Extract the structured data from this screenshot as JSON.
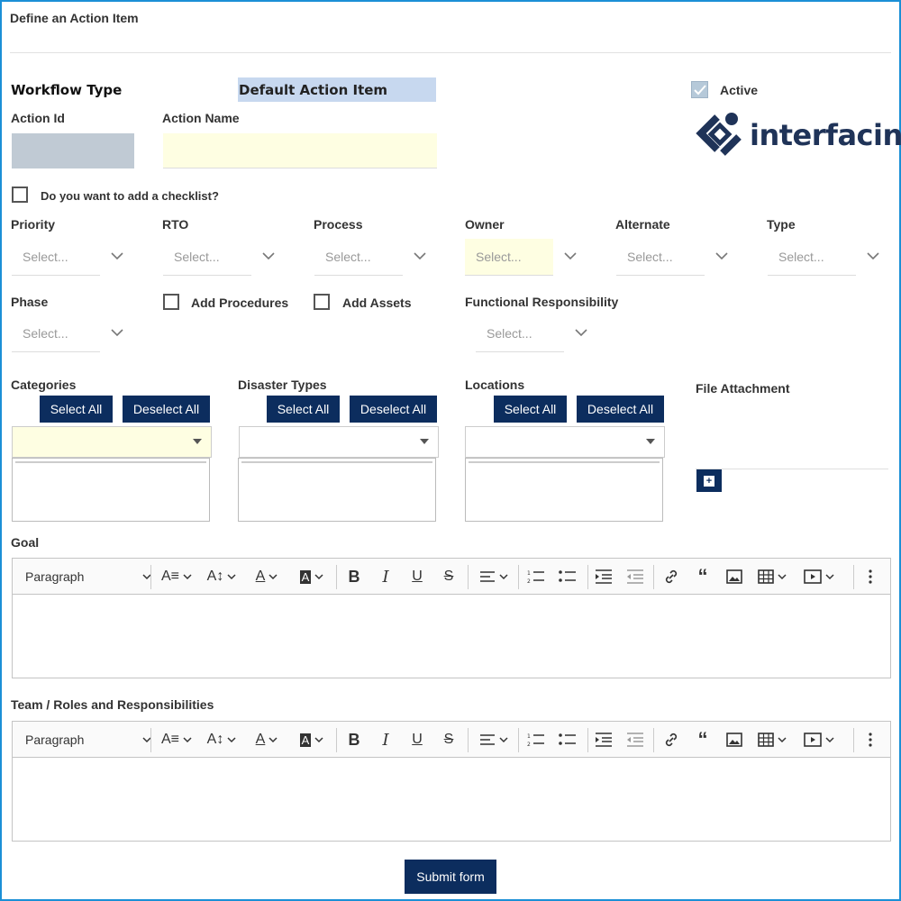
{
  "form": {
    "title": "Define an Action Item",
    "workflow_type_label": "Workflow Type",
    "workflow_type_value": "Default Action Item",
    "active_label": "Active",
    "active_checked": true,
    "action_id_label": "Action Id",
    "action_name_label": "Action Name",
    "checklist_label": "Do you want to add a checklist?"
  },
  "logo": {
    "text": "interfacing.",
    "color": "#1f3358"
  },
  "selects_row1": [
    {
      "label": "Priority",
      "placeholder": "Select..."
    },
    {
      "label": "RTO",
      "placeholder": "Select..."
    },
    {
      "label": "Process",
      "placeholder": "Select..."
    },
    {
      "label": "Owner",
      "placeholder": "Select..."
    },
    {
      "label": "Alternate",
      "placeholder": "Select..."
    },
    {
      "label": "Type",
      "placeholder": "Select..."
    }
  ],
  "phase": {
    "label": "Phase",
    "placeholder": "Select..."
  },
  "add_procedures_label": "Add Procedures",
  "add_assets_label": "Add Assets",
  "functional_responsibility": {
    "label": "Functional Responsibility",
    "placeholder": "Select..."
  },
  "multi_selects": [
    {
      "label": "Categories",
      "select_all": "Select All",
      "deselect_all": "Deselect All"
    },
    {
      "label": "Disaster Types",
      "select_all": "Select All",
      "deselect_all": "Deselect All"
    },
    {
      "label": "Locations",
      "select_all": "Select All",
      "deselect_all": "Deselect All"
    }
  ],
  "file_attachment_label": "File Attachment",
  "editors": [
    {
      "label": "Goal",
      "paragraph": "Paragraph"
    },
    {
      "label": "Team / Roles and Responsibilities",
      "paragraph": "Paragraph"
    }
  ],
  "submit_label": "Submit form",
  "colors": {
    "accent": "#0c2d5e",
    "border": "#1b8fd6",
    "required_bg": "#fefee2"
  }
}
